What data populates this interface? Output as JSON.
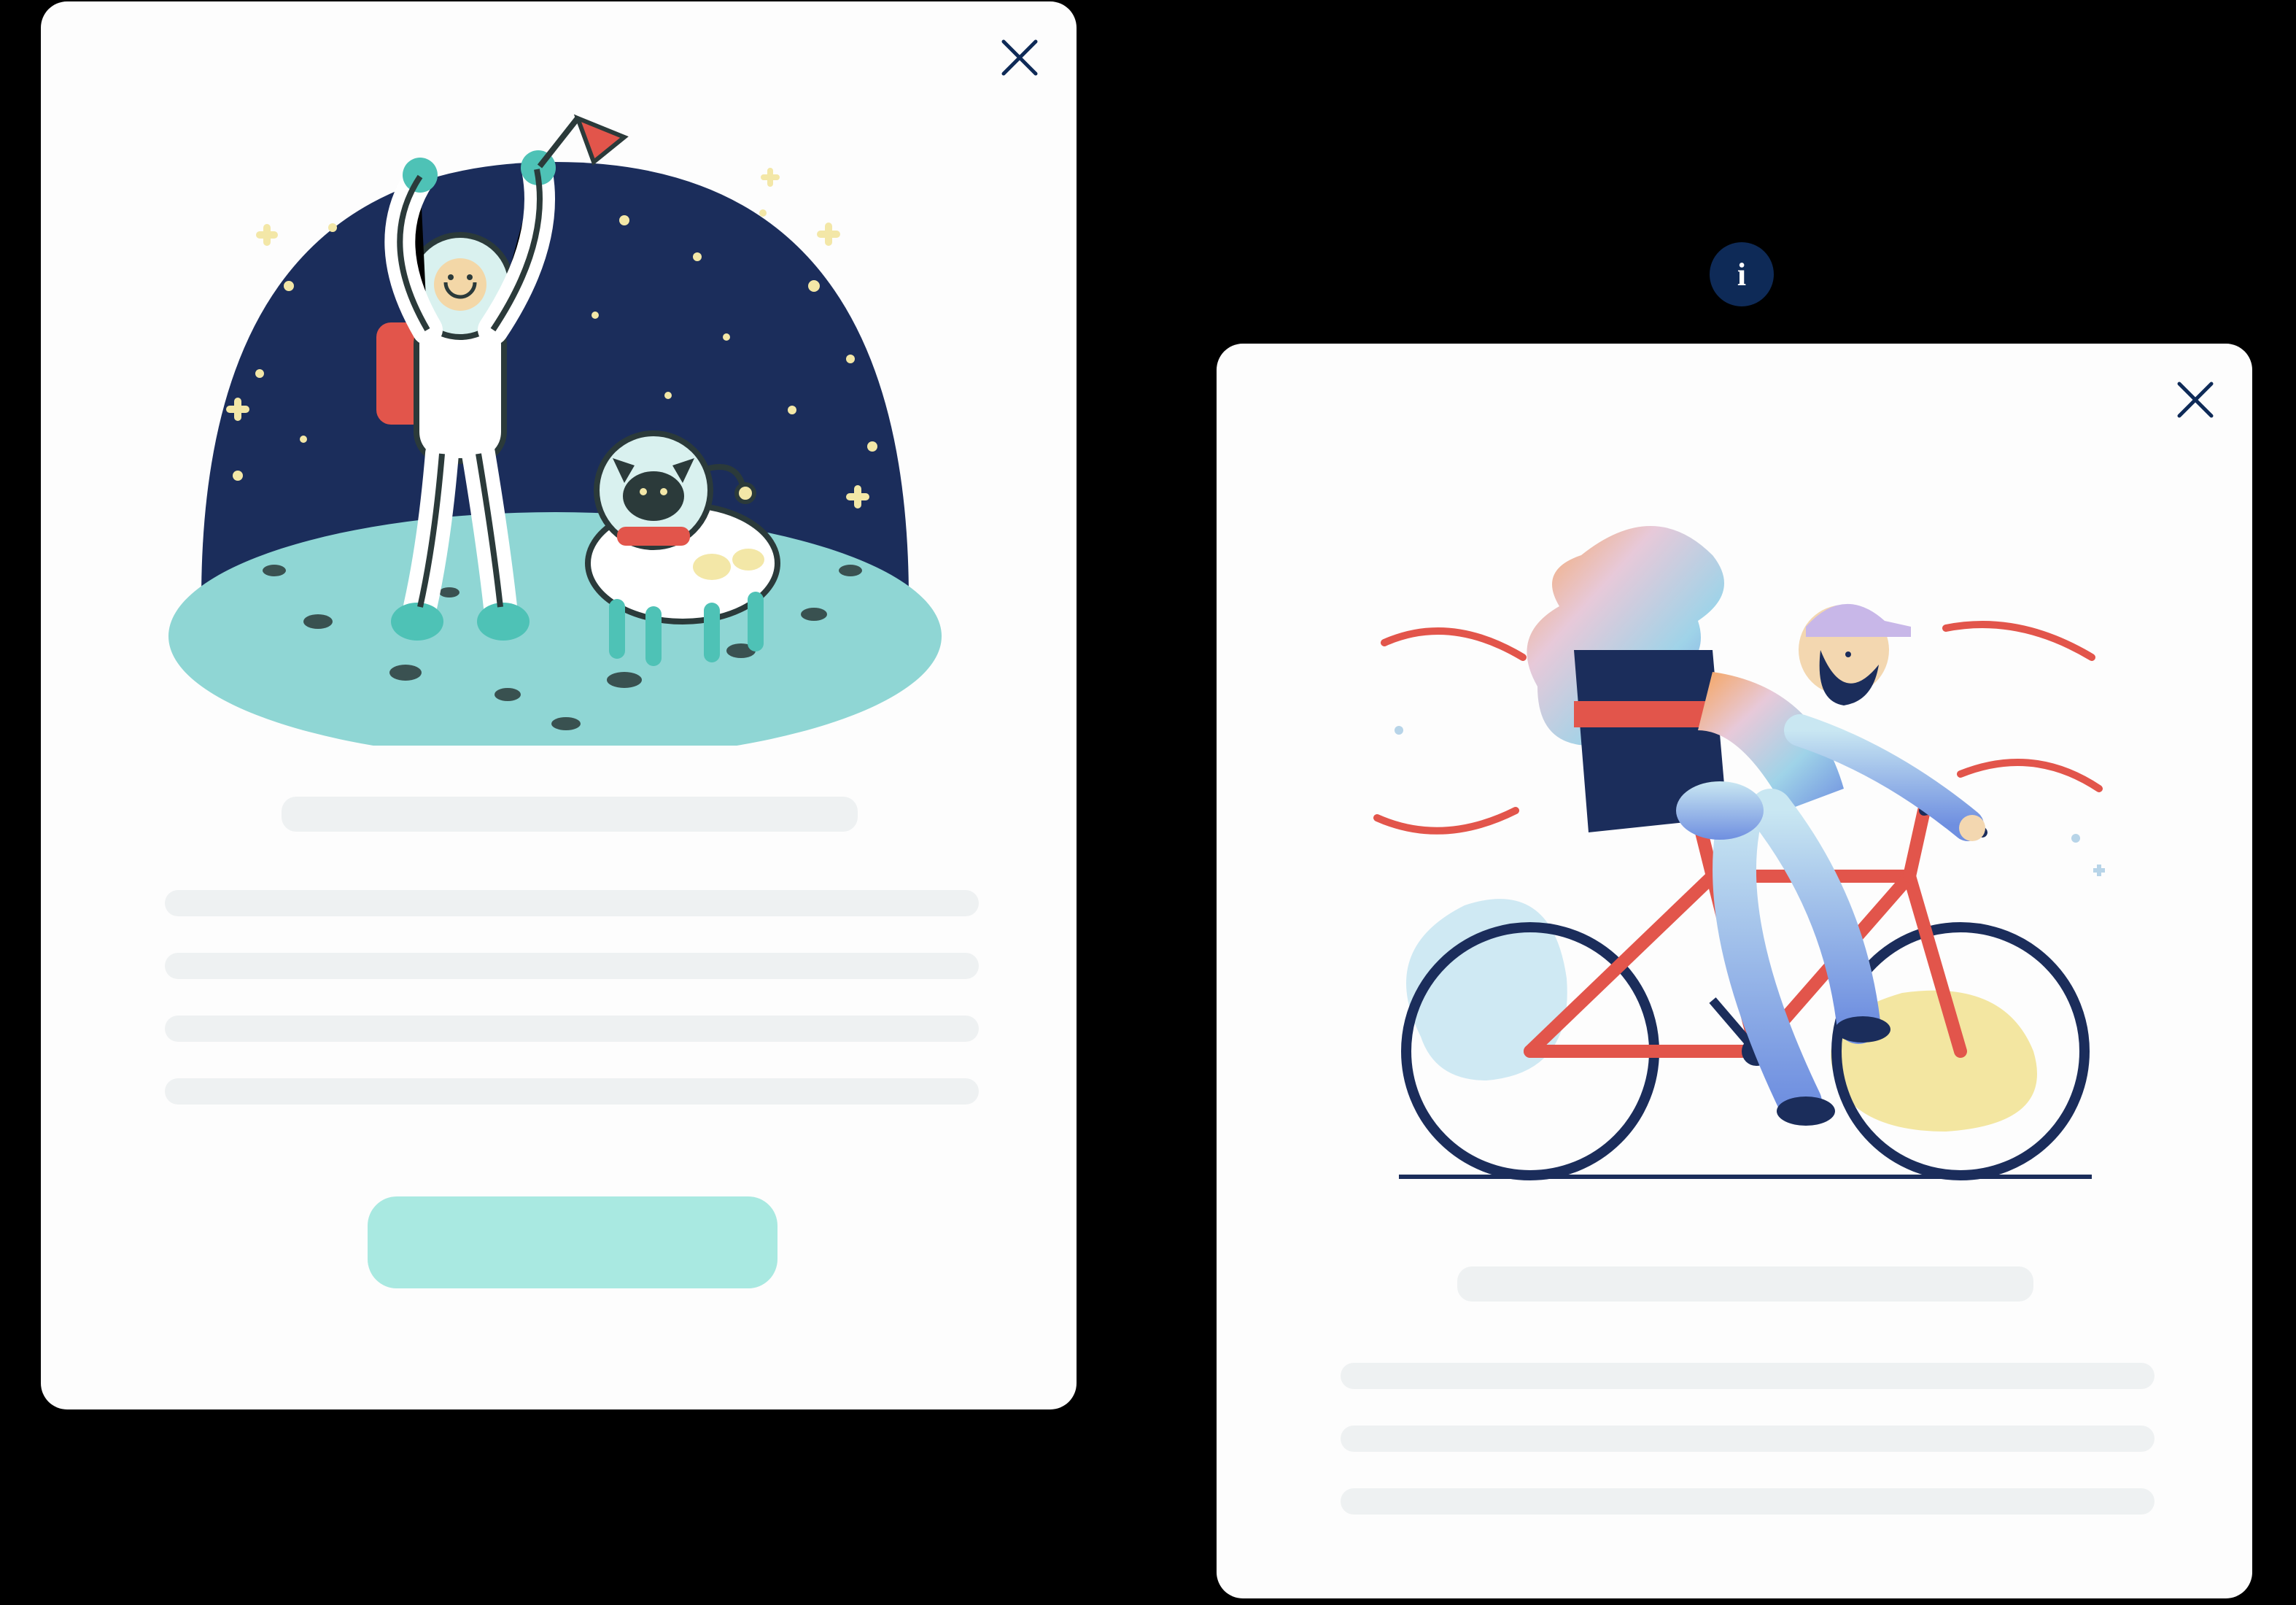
{
  "colors": {
    "accent": "#A9E9E1",
    "dark_navy": "#0E2A57",
    "skeleton": "#eef1f2",
    "card_bg": "#fdfdfd"
  },
  "info_badge": {
    "label": "i"
  },
  "modal_left": {
    "close_label": "Close",
    "illustration": "astronaut-with-flag-and-cat-on-moon",
    "title_placeholder": "",
    "body_lines": [
      "",
      "",
      "",
      ""
    ],
    "cta_label": ""
  },
  "modal_right": {
    "close_label": "Close",
    "illustration": "courier-riding-bicycle-with-backpack",
    "title_placeholder": "",
    "body_lines": [
      "",
      "",
      ""
    ]
  }
}
